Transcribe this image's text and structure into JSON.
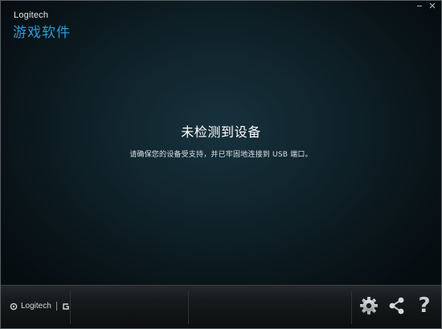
{
  "window": {
    "brand": "Logitech",
    "app_title": "游戏软件",
    "controls": {
      "minimize_icon": "minimize-icon",
      "close_icon": "close-icon"
    }
  },
  "main": {
    "status_title": "未检测到设备",
    "status_description": "请确保您的设备受支持，并已牢固地连接到 USB 端口。"
  },
  "footer": {
    "brand_text": "Logitech",
    "brand_icon": "logitech-mark-icon",
    "g_icon": "g-logo-icon",
    "settings_icon": "gear-icon",
    "share_icon": "share-icon",
    "help_label": "?"
  },
  "colors": {
    "accent": "#2f9bd5",
    "background": "#0f2229",
    "footer": "#171a1c",
    "text": "#ffffff"
  }
}
